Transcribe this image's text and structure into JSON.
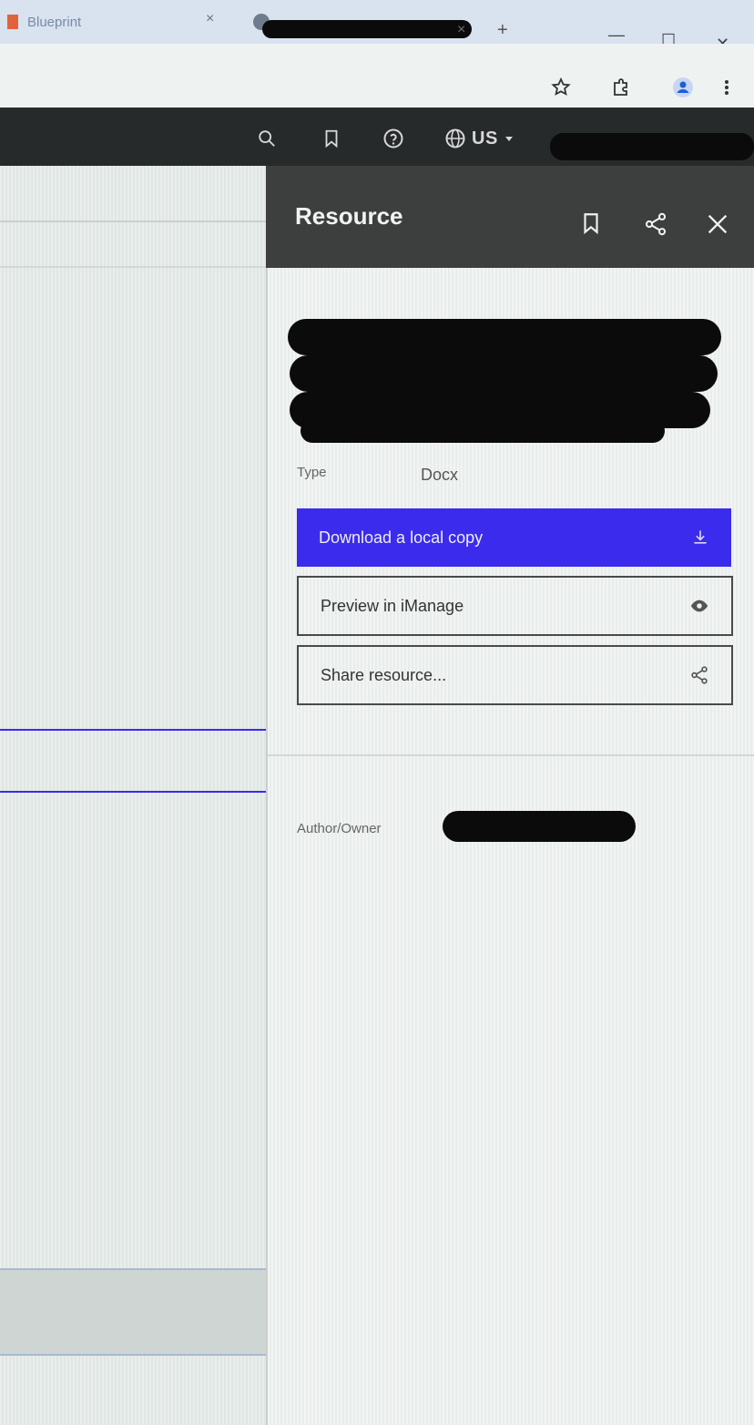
{
  "browser": {
    "tabs": [
      {
        "label": "Blueprint",
        "close": "×"
      },
      {
        "label": "",
        "close": "×"
      }
    ],
    "new_tab": "+",
    "window": {
      "minimize": "—",
      "maximize": "☐",
      "close": "✕"
    }
  },
  "site_header": {
    "language": "US"
  },
  "panel": {
    "title": "Resource",
    "type_label": "Type",
    "type_value": "Docx",
    "buttons": {
      "download": "Download a local copy",
      "preview": "Preview in iManage",
      "share": "Share resource..."
    },
    "author_label": "Author/Owner"
  },
  "colors": {
    "primary": "#3b2bec",
    "panel_header": "#3c3f3e",
    "site_header": "#272a2b",
    "tab_strip": "#d9e2ef"
  }
}
